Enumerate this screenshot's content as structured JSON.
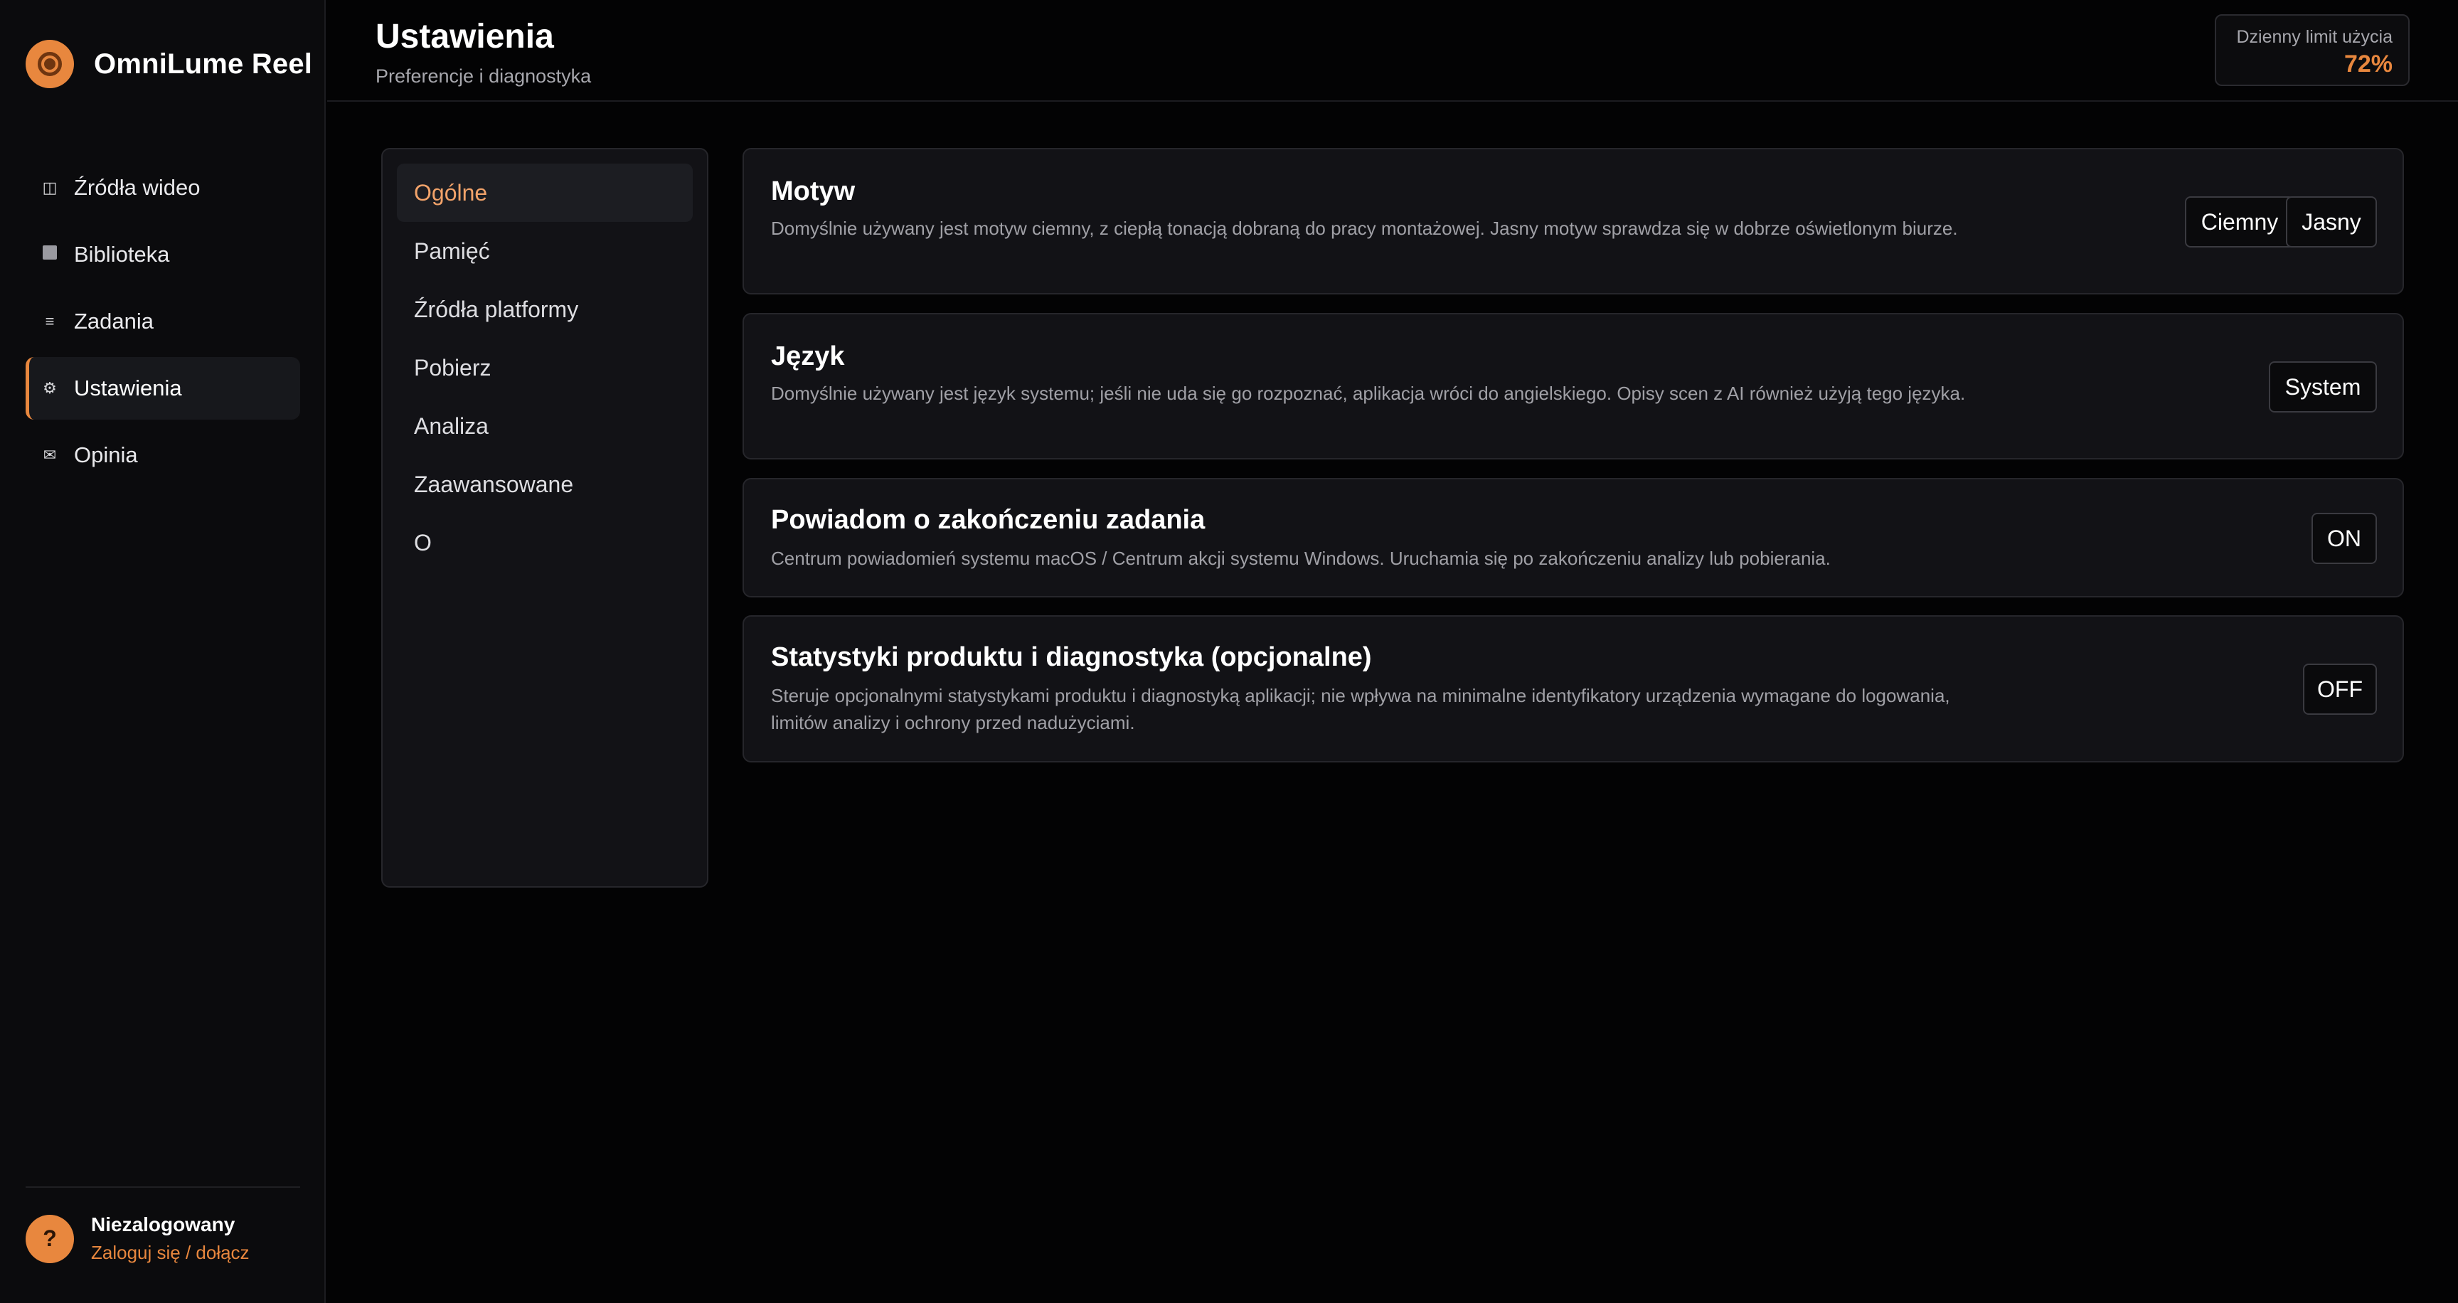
{
  "app": {
    "name": "OmniLume Reel",
    "logo_icon": "film-reel-icon",
    "accent_color": "#e8873e"
  },
  "sidebar": {
    "items": [
      {
        "label": "Źródła wideo",
        "icon": "columns-icon",
        "active": false
      },
      {
        "label": "Biblioteka",
        "icon": "square-icon",
        "active": false
      },
      {
        "label": "Zadania",
        "icon": "list-icon",
        "active": false
      },
      {
        "label": "Ustawienia",
        "icon": "gear-icon",
        "active": true
      },
      {
        "label": "Opinia",
        "icon": "envelope-icon",
        "active": false
      }
    ],
    "user": {
      "avatar_text": "?",
      "name": "Niezalogowany",
      "login_link": "Zaloguj się / dołącz"
    }
  },
  "header": {
    "title": "Ustawienia",
    "subtitle": "Preferencje i diagnostyka",
    "usage": {
      "label": "Dzienny limit użycia",
      "value": "72%"
    }
  },
  "settings_menu": {
    "items": [
      {
        "label": "Ogólne",
        "active": true
      },
      {
        "label": "Pamięć",
        "active": false
      },
      {
        "label": "Źródła platformy",
        "active": false
      },
      {
        "label": "Pobierz",
        "active": false
      },
      {
        "label": "Analiza",
        "active": false
      },
      {
        "label": "Zaawansowane",
        "active": false
      },
      {
        "label": "O",
        "active": false
      }
    ]
  },
  "settings": {
    "theme": {
      "title": "Motyw",
      "description": "Domyślnie używany jest motyw ciemny, z ciepłą tonacją dobraną do pracy montażowej. Jasny motyw sprawdza się w dobrze oświetlonym biurze.",
      "options": [
        "Ciemny",
        "Jasny"
      ]
    },
    "language": {
      "title": "Język",
      "description": "Domyślnie używany jest język systemu; jeśli nie uda się go rozpoznać, aplikacja wróci do angielskiego. Opisy scen z AI również użyją tego języka.",
      "value": "System"
    },
    "notify": {
      "title": "Powiadom o zakończeniu zadania",
      "description": "Centrum powiadomień systemu macOS / Centrum akcji systemu Windows. Uruchamia się po zakończeniu analizy lub pobierania.",
      "value": "ON"
    },
    "telemetry": {
      "title": "Statystyki produktu i diagnostyka (opcjonalne)",
      "description": "Steruje opcjonalnymi statystykami produktu i diagnostyką aplikacji; nie wpływa na minimalne identyfikatory urządzenia wymagane do logowania, limitów analizy i ochrony przed nadużyciami.",
      "value": "OFF"
    }
  }
}
